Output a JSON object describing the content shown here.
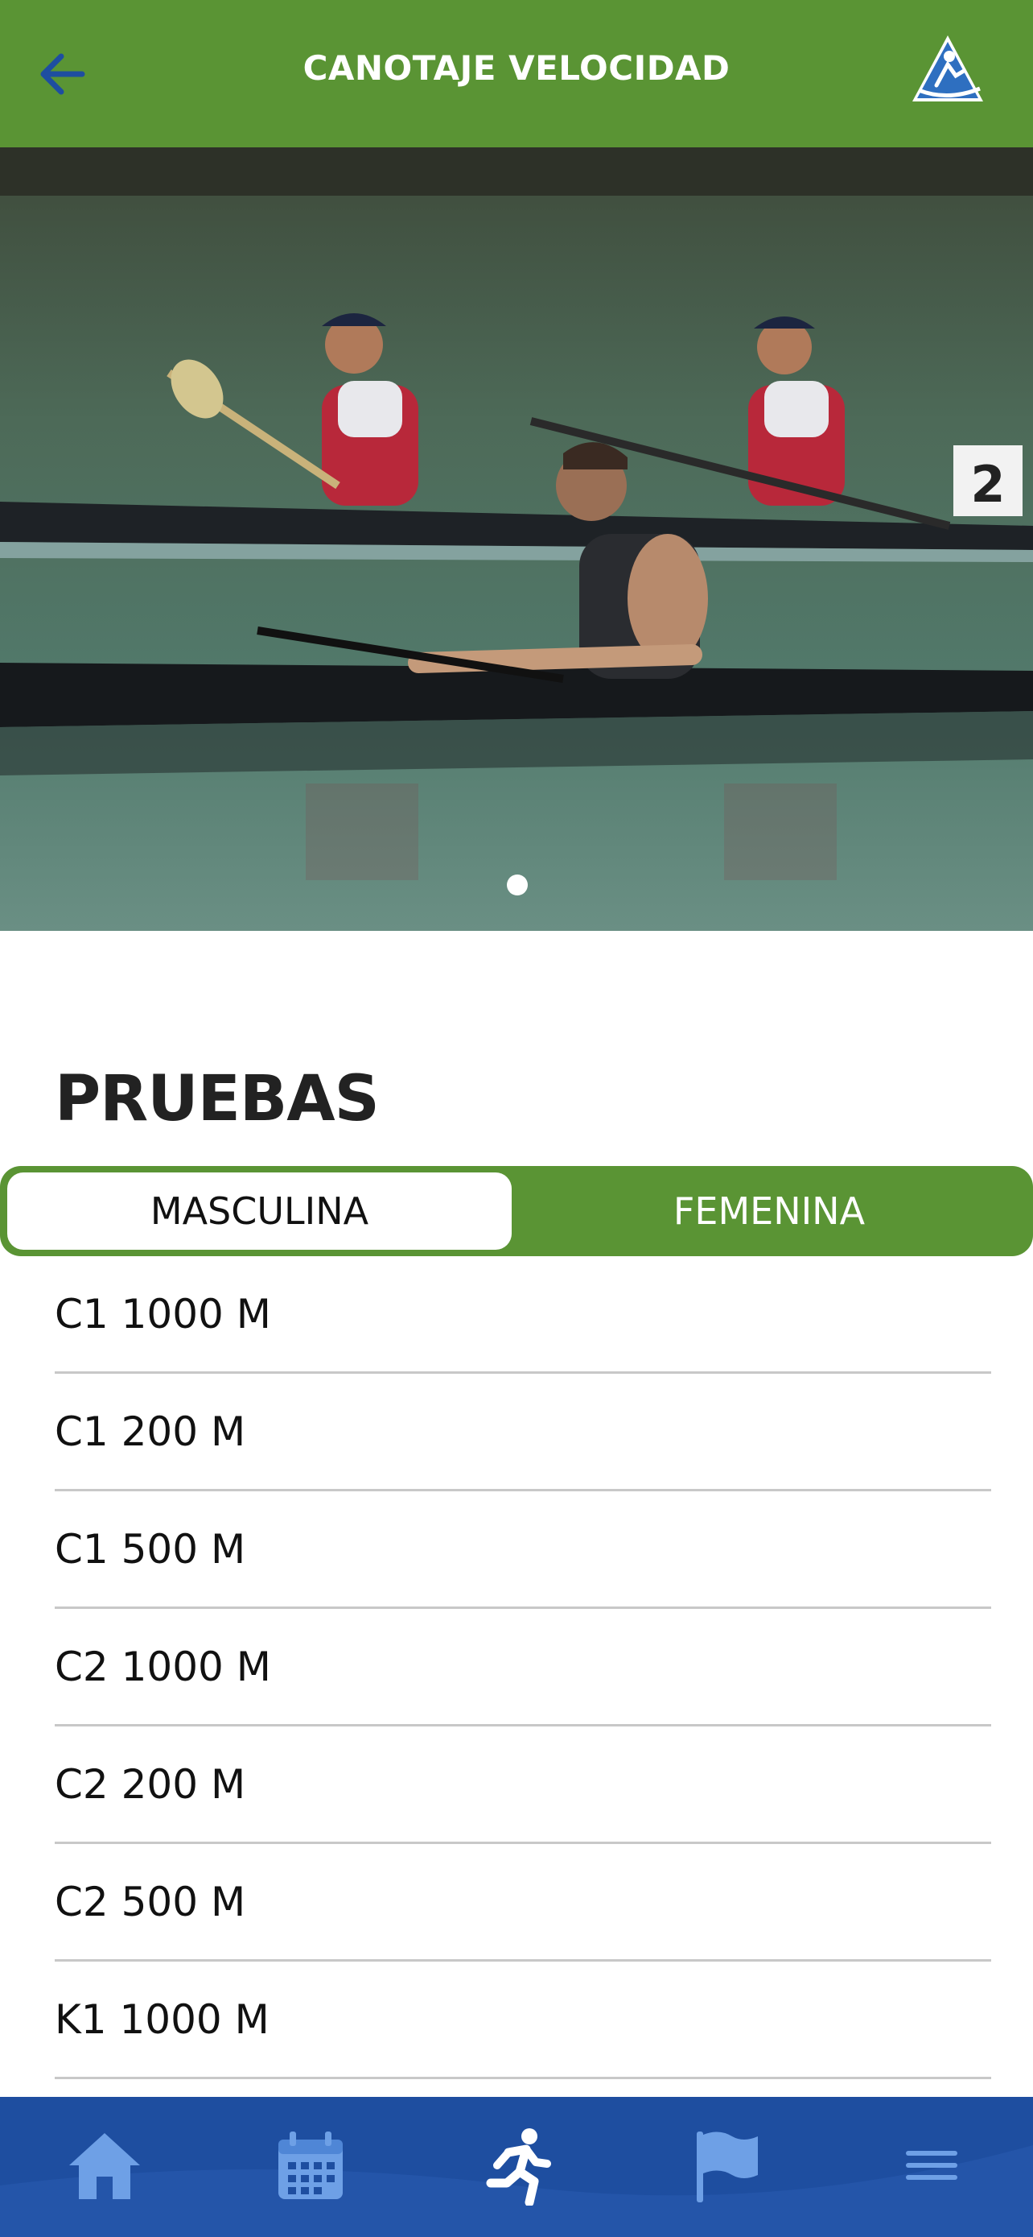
{
  "header": {
    "title": "CANOTAJE VELOCIDAD",
    "back_icon": "arrow-left-icon",
    "logo_icon": "canoe-sprint-logo-icon",
    "color": "#5a9434"
  },
  "hero": {
    "carousel_pages": 1,
    "active_page": 1
  },
  "section": {
    "title": "PRUEBAS"
  },
  "tabs": {
    "items": [
      {
        "label": "MASCULINA",
        "selected": true
      },
      {
        "label": "FEMENINA",
        "selected": false
      }
    ]
  },
  "events": [
    {
      "label": "C1 1000 M"
    },
    {
      "label": "C1 200 M"
    },
    {
      "label": "C1 500 M"
    },
    {
      "label": "C2 1000 M"
    },
    {
      "label": "C2 200 M"
    },
    {
      "label": "C2 500 M"
    },
    {
      "label": "K1 1000 M"
    }
  ],
  "bottom_nav": {
    "color": "#1e4ea0",
    "items": [
      {
        "icon": "home-icon"
      },
      {
        "icon": "calendar-icon"
      },
      {
        "icon": "running-person-icon"
      },
      {
        "icon": "flag-icon"
      },
      {
        "icon": "menu-icon"
      }
    ]
  }
}
